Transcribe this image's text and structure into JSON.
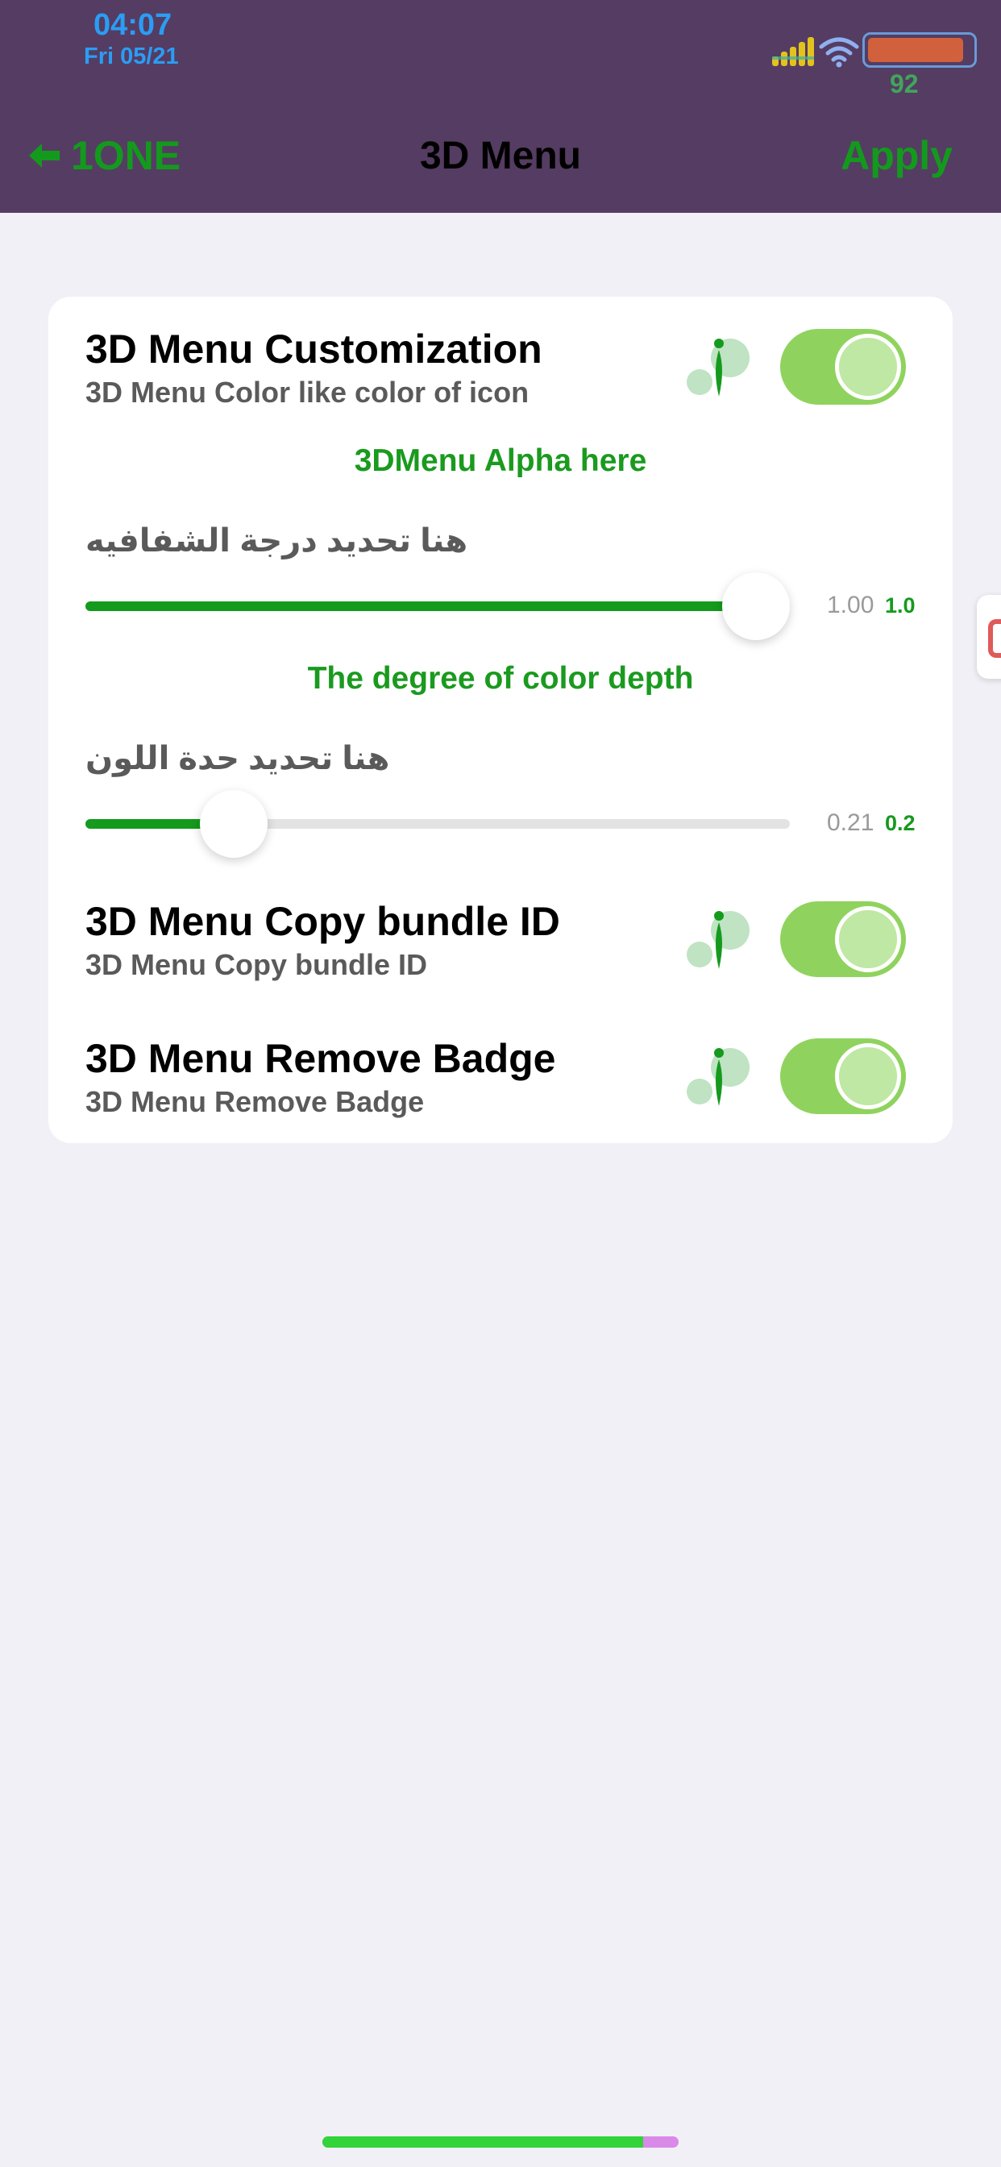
{
  "status_bar": {
    "time": "04:07",
    "date": "Fri 05/21",
    "battery_percent": "92",
    "battery_level": 0.92,
    "signal_icon": "signal-bars-icon",
    "wifi_icon": "wifi-icon",
    "colors": {
      "time": "#2a9df4",
      "battery": "#d0613c",
      "percent": "#3fa65a"
    }
  },
  "nav": {
    "back_label": "1ONE",
    "back_icon": "arrow-left-icon",
    "title": "3D Menu",
    "apply_label": "Apply",
    "background": "#553c62",
    "accent": "#139a1d"
  },
  "settings": {
    "customization": {
      "title": "3D Menu Customization",
      "subtitle": "3D Menu Color like color of icon",
      "enabled": true
    },
    "alpha_section": {
      "heading": "3DMenu Alpha here",
      "label_ar": "هنا تحديد درجة الشفافيه",
      "value_text": "1.00",
      "value_short": "1.0",
      "value": 1.0
    },
    "depth_section": {
      "heading": "The degree of color depth",
      "label_ar": "هنا تحديد حدة اللون",
      "value_text": "0.21",
      "value_short": "0.2",
      "value": 0.21
    },
    "copy_bundle": {
      "title": "3D Menu Copy bundle ID",
      "subtitle": "3D Menu Copy bundle ID",
      "enabled": true
    },
    "remove_badge": {
      "title": "3D Menu Remove Badge",
      "subtitle": "3D Menu Remove Badge",
      "enabled": true
    }
  },
  "home_indicator": {
    "progress": 0.9
  }
}
